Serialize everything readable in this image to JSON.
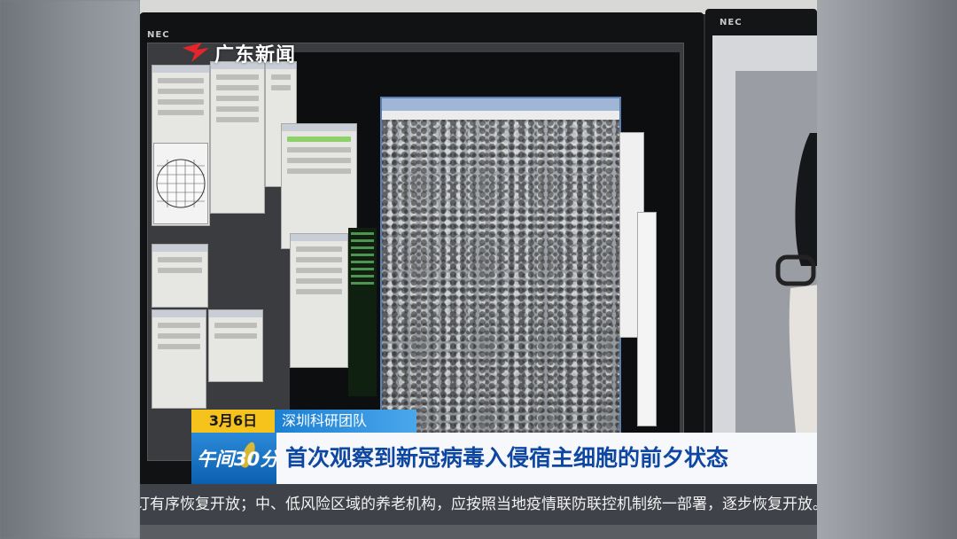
{
  "monitor": {
    "brand_left": "NEC",
    "brand_right": "NEC"
  },
  "logo": {
    "text": "广东新闻",
    "icon": "guangdong-tv-logo-icon"
  },
  "lower_third": {
    "date": "3月6日",
    "tag": "深圳科研团队",
    "program": "午间30分",
    "headline": "首次观察到新冠病毒入侵宿主细胞的前夕状态"
  },
  "ticker": {
    "text": "订有序恢复开放；中、低风险区域的养老机构，应按照当地疫情联防联控机制统一部署，逐步恢复开放。 云"
  },
  "colors": {
    "date_bg": "#f6c31c",
    "tag_bg": "#1b7fd2",
    "headline_text": "#0e47a1",
    "ticker_bg": "#3f4248"
  }
}
